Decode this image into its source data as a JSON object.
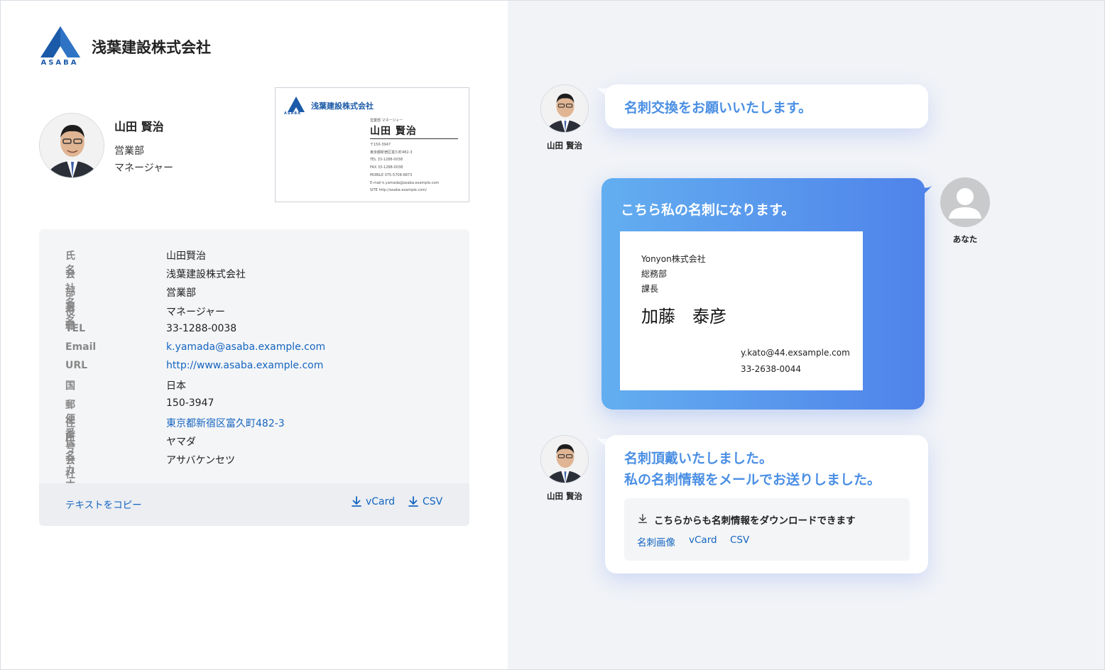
{
  "company": {
    "name": "浅葉建設株式会社",
    "logo_word": "ASABA",
    "brand_color": "#1b5aa8"
  },
  "profile": {
    "name": "山田 賢治",
    "department": "営業部",
    "title": "マネージャー"
  },
  "mini_card": {
    "company": "浅葉建設株式会社",
    "logo_word": "ASABA",
    "role": "営業部 マネージャー",
    "name": "山田 賢治",
    "info": [
      "〒150-3947",
      "東京都新宿区富久町482-3",
      "TEL 33-1288-0038",
      "FAX 33-1288-0038",
      "MOBILE 075-5708-6873",
      "E-mail k.yamada@asaba.example.com",
      "SITE http://asaba.example.com/"
    ]
  },
  "details": {
    "rows": [
      {
        "label": "氏名",
        "value": "山田賢治",
        "link": false
      },
      {
        "label": "会社名",
        "value": "浅葉建設株式会社",
        "link": false
      },
      {
        "label": "部署名",
        "value": "営業部",
        "link": false
      },
      {
        "label": "役職",
        "value": "マネージャー",
        "link": false
      },
      {
        "label": "TEL",
        "value": "33-1288-0038",
        "link": false
      },
      {
        "label": "Email",
        "value": "k.yamada@asaba.example.com",
        "link": true
      },
      {
        "label": "URL",
        "value": "http://www.asaba.example.com",
        "link": true
      },
      {
        "label": "国",
        "value": "日本",
        "link": false
      },
      {
        "label": "郵便番号",
        "value": "150-3947",
        "link": false
      },
      {
        "label": "住所",
        "value": "東京都新宿区富久町482-3",
        "link": true
      },
      {
        "label": "氏名カナ",
        "value": "ヤマダ",
        "link": false
      },
      {
        "label": "会社カナ",
        "value": "アサバケンセツ",
        "link": false
      }
    ],
    "copy_label": "テキストをコピー",
    "vcard_label": "vCard",
    "csv_label": "CSV"
  },
  "chat": {
    "sender_name": "山田 賢治",
    "you_label": "あなた",
    "msg1": "名刺交換をお願いいたします。",
    "msg2": "こちら私の名刺になります。",
    "your_card": {
      "company": "Yonyon株式会社",
      "dept": "総務部",
      "title": "課長",
      "name": "加藤　泰彦",
      "email": "y.kato@44.exsample.com",
      "tel": "33-2638-0044"
    },
    "msg3_line1": "名刺頂戴いたしました。",
    "msg3_line2": "私の名刺情報をメールでお送りしました。",
    "download_title": "こちらからも名刺情報をダウンロードできます",
    "download_links": [
      "名刺画像",
      "vCard",
      "CSV"
    ]
  },
  "colors": {
    "link": "#1565c0",
    "chat_text": "#4a8fe4",
    "gradient_start": "#63aef0",
    "gradient_end": "#4f83ea"
  }
}
